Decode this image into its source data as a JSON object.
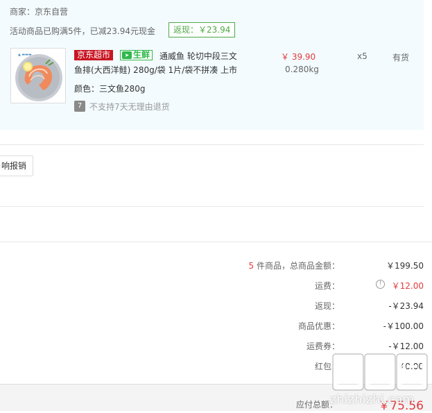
{
  "seller": "商家：京东自营",
  "promo": {
    "text": "活动商品已购满5件，已减23.94元现金",
    "cashback_badge": "返现：￥23.94"
  },
  "product": {
    "image_icon": "salmon-steak-photo",
    "tag_supermarket": "京东超市",
    "tag_fresh_icon": "fresh-leaf-icon",
    "tag_fresh": "生鲜",
    "title_line1": "通威鱼 轮切中段三文",
    "title_line2": "鱼排(大西洋鲑) 280g/袋 1片/袋不拼凑 上市",
    "color": "颜色：三文鱼280g",
    "return_icon": "7",
    "return_policy": "不支持7天无理由退货",
    "price": "￥ 39.90",
    "weight": "0.280kg",
    "quantity": "x5",
    "stock": "有货"
  },
  "expense_button": "响报销",
  "summary": {
    "count": "5",
    "count_suffix": " 件商品，总商品金额：",
    "total_goods": "￥199.50",
    "shipping_label": "运费：",
    "shipping": "￥12.00",
    "cashback_label": "返现：",
    "cashback": "-￥23.94",
    "discount_label": "商品优惠：",
    "discount": "-￥100.00",
    "coupon_label": "运费券：",
    "coupon": "-￥12.00",
    "redpacket_label": "红包：",
    "redpacket": "￥0.00",
    "payable_label": "应付总额：",
    "payable": "￥75.56"
  },
  "watermark": {
    "logo_text": "值值值",
    "site": "zhizhizhi.com"
  },
  "colors": {
    "accent_red": "#e4393c",
    "jd_red": "#c81623",
    "fresh_green": "#2eb84b",
    "cashback_green": "#4fa845",
    "block_bg": "#f3fbfe"
  }
}
